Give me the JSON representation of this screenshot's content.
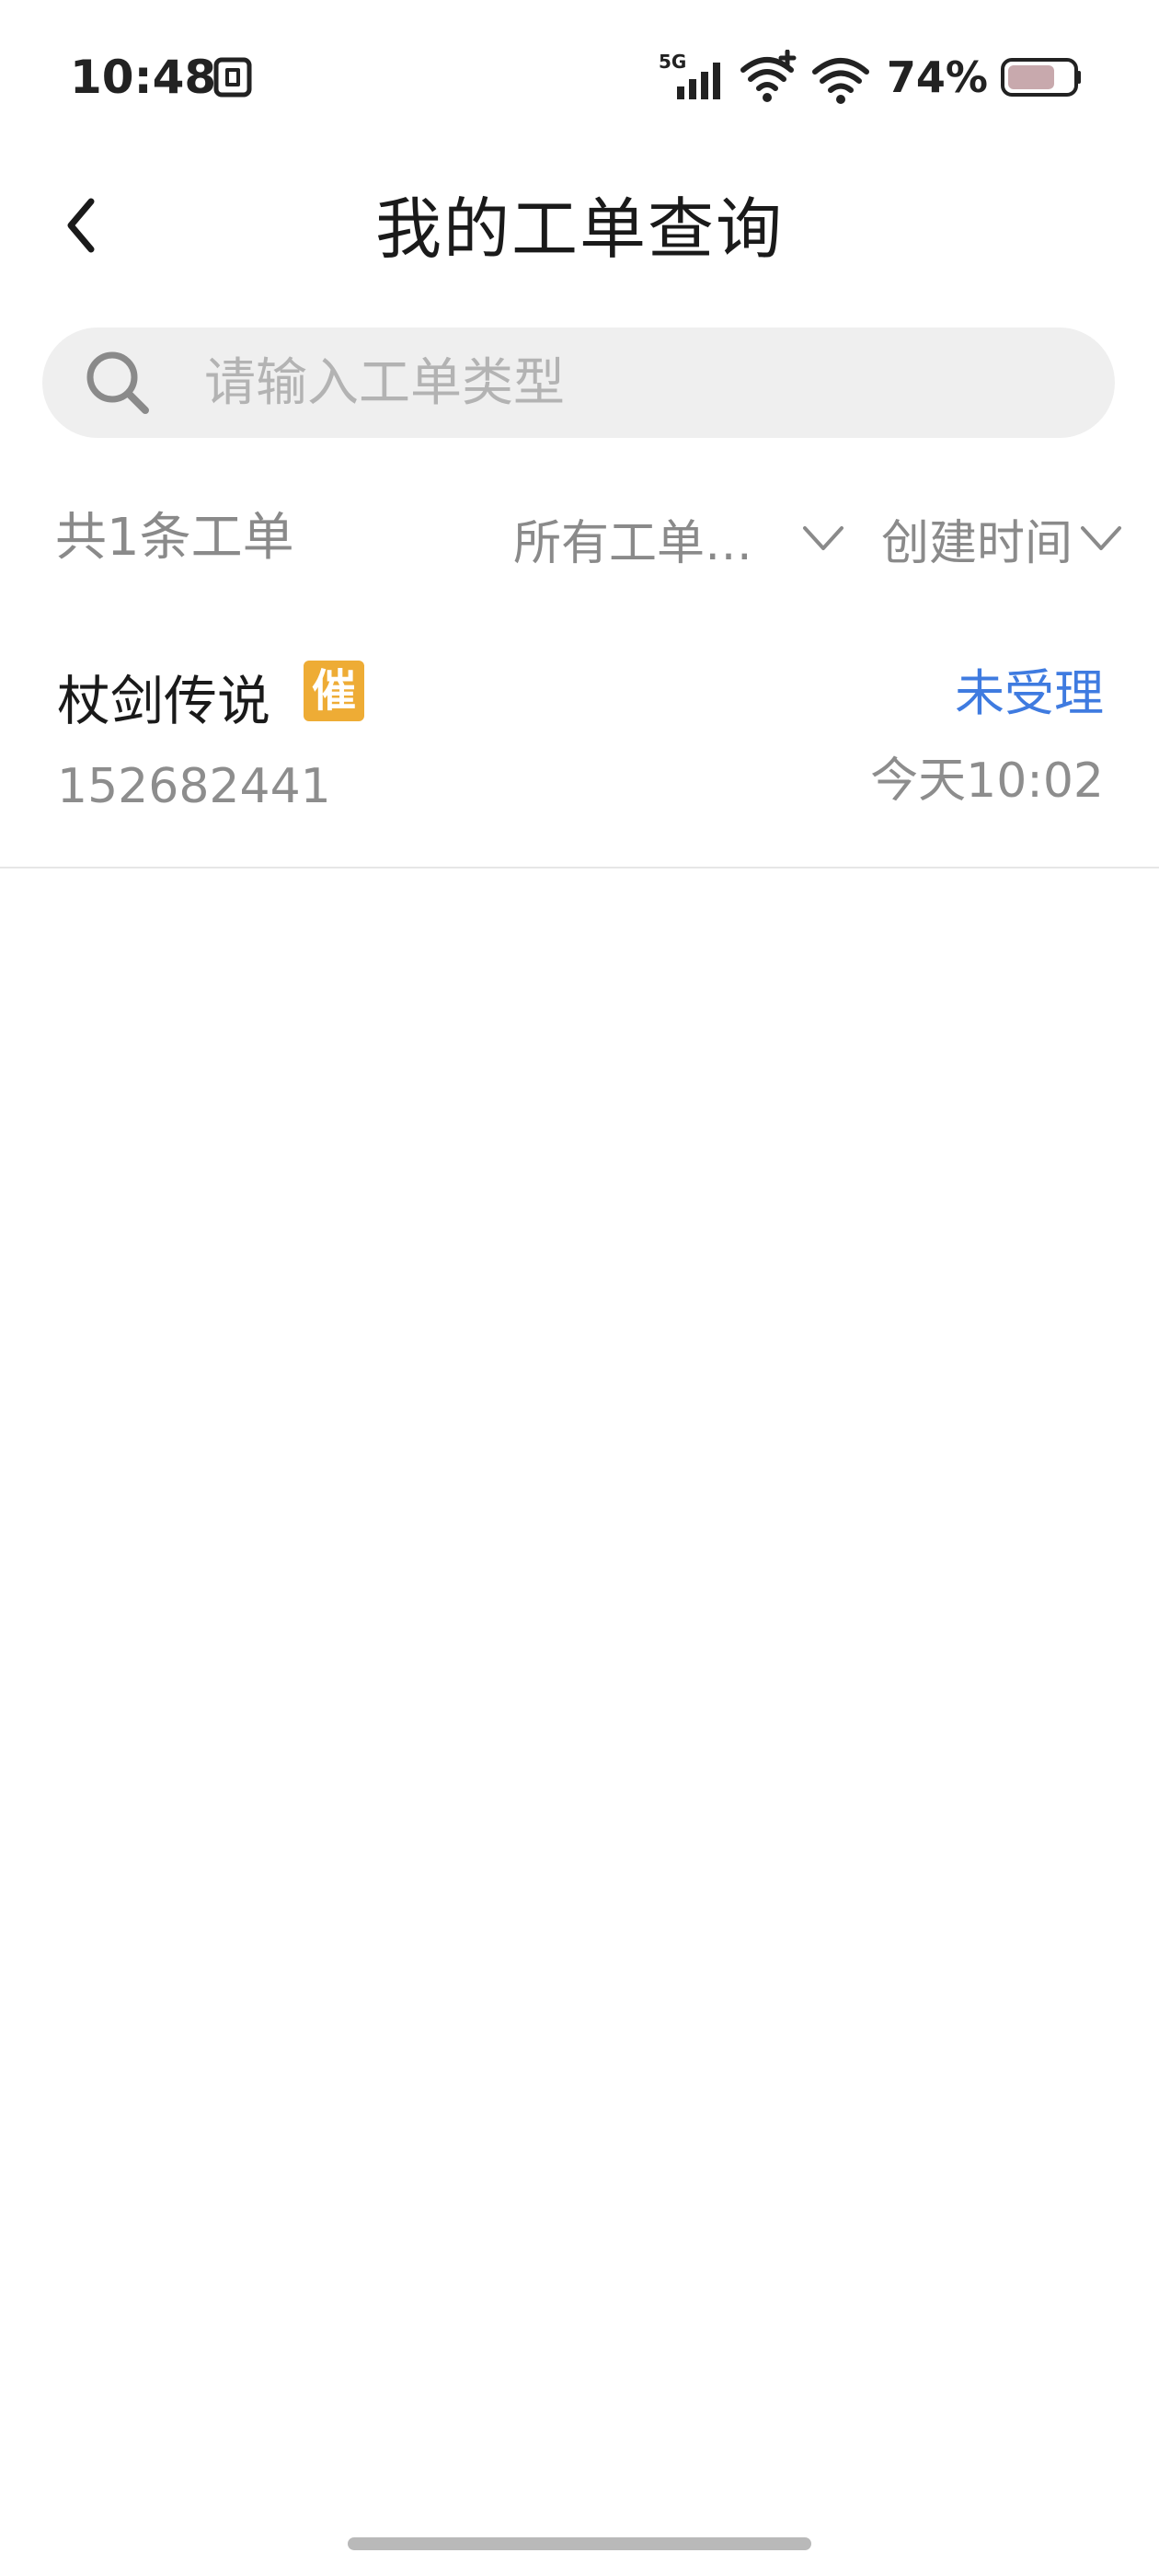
{
  "status_bar": {
    "time": "10:48",
    "network_label": "5G",
    "battery_text": "74%",
    "battery_level": 0.74,
    "icons": [
      "sim-card-icon",
      "signal-icon",
      "wifi-plus-icon",
      "wifi-icon",
      "battery-icon"
    ]
  },
  "header": {
    "title": "我的工单查询",
    "back_icon": "chevron-left-icon"
  },
  "search": {
    "placeholder": "请输入工单类型",
    "value": ""
  },
  "filters": {
    "count_text": "共1条工单",
    "status_filter_label": "所有工单…",
    "sort_label": "创建时间"
  },
  "orders": [
    {
      "name": "杖剑传说",
      "badge": "催",
      "status": "未受理",
      "id": "152682441",
      "time": "今天10:02"
    }
  ],
  "colors": {
    "accent_blue": "#3f7be0",
    "badge_orange": "#eeac35",
    "secondary_text": "#8d8d8d",
    "search_bg": "#efefef",
    "divider": "#e6e6e6"
  }
}
